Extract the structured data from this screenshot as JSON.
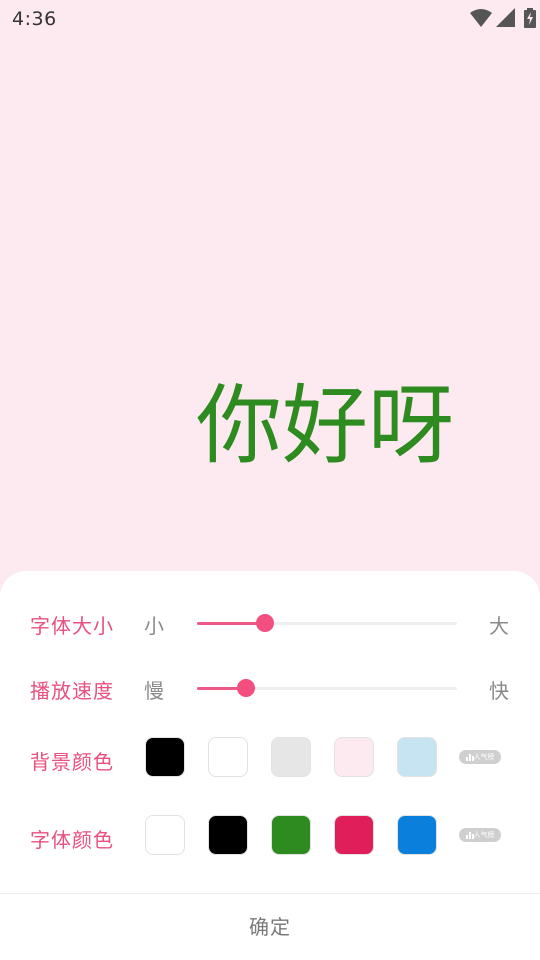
{
  "status_bar": {
    "time": "4:36",
    "icons": [
      "wifi-icon",
      "signal-icon",
      "battery-charging-icon"
    ]
  },
  "preview": {
    "text": "你好呀",
    "text_color": "#2e8b1f",
    "background_color": "#fdeaf0"
  },
  "settings": {
    "font_size": {
      "label": "字体大小",
      "min_label": "小",
      "max_label": "大",
      "value_fraction": 0.26
    },
    "speed": {
      "label": "播放速度",
      "min_label": "慢",
      "max_label": "快",
      "value_fraction": 0.19
    },
    "background_color": {
      "label": "背景颜色",
      "swatches": [
        "#000000",
        "#ffffff",
        "#e6e6e6",
        "#fdeaf0",
        "#c6e4f2"
      ],
      "custom_chip": "人气榜"
    },
    "text_color": {
      "label": "字体颜色",
      "swatches": [
        "#ffffff",
        "#000000",
        "#2e8b1f",
        "#e01e5a",
        "#0a7fdc"
      ],
      "custom_chip": "人气榜"
    }
  },
  "confirm_label": "确定",
  "accent_color": "#ee5887"
}
